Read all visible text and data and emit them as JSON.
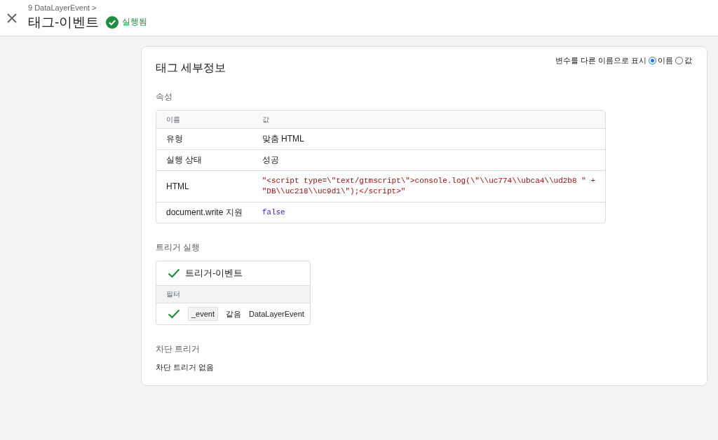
{
  "header": {
    "breadcrumb": "9 DataLayerEvent >",
    "title": "태그-이벤트",
    "status": "실행됨"
  },
  "card": {
    "title": "태그 세부정보",
    "display_toggle": {
      "label": "변수를 다른 이름으로 표시",
      "options": [
        {
          "label": "이름",
          "selected": true
        },
        {
          "label": "값",
          "selected": false
        }
      ]
    },
    "properties": {
      "heading": "속성",
      "columns": [
        "이름",
        "값"
      ],
      "rows": [
        {
          "name": "유형",
          "kind": "text",
          "value": [
            "맞춤 HTML"
          ]
        },
        {
          "name": "실행 상태",
          "kind": "text",
          "value": [
            "성공"
          ]
        },
        {
          "name": "HTML",
          "kind": "string",
          "value": [
            "\"<script type=\\\"text/gtmscript\\\">console.log(\\\"\\\\uc774\\\\ubca4\\\\ud2b8 \" +",
            "\"DB\\\\uc218\\\\uc9d1\\\");</script>\""
          ]
        },
        {
          "name": "document.write 지원",
          "kind": "literal",
          "value": [
            "false"
          ]
        }
      ]
    },
    "firing_triggers": {
      "heading": "트리거 실행",
      "triggers": [
        {
          "name": "트리거-이벤트",
          "filter_heading": "필터",
          "filters": [
            {
              "variable": "_event",
              "operator": "같음",
              "value": "DataLayerEvent"
            }
          ]
        }
      ]
    },
    "blocking_triggers": {
      "heading": "차단 트리거",
      "empty_text": "차단 트리거 없음"
    }
  }
}
